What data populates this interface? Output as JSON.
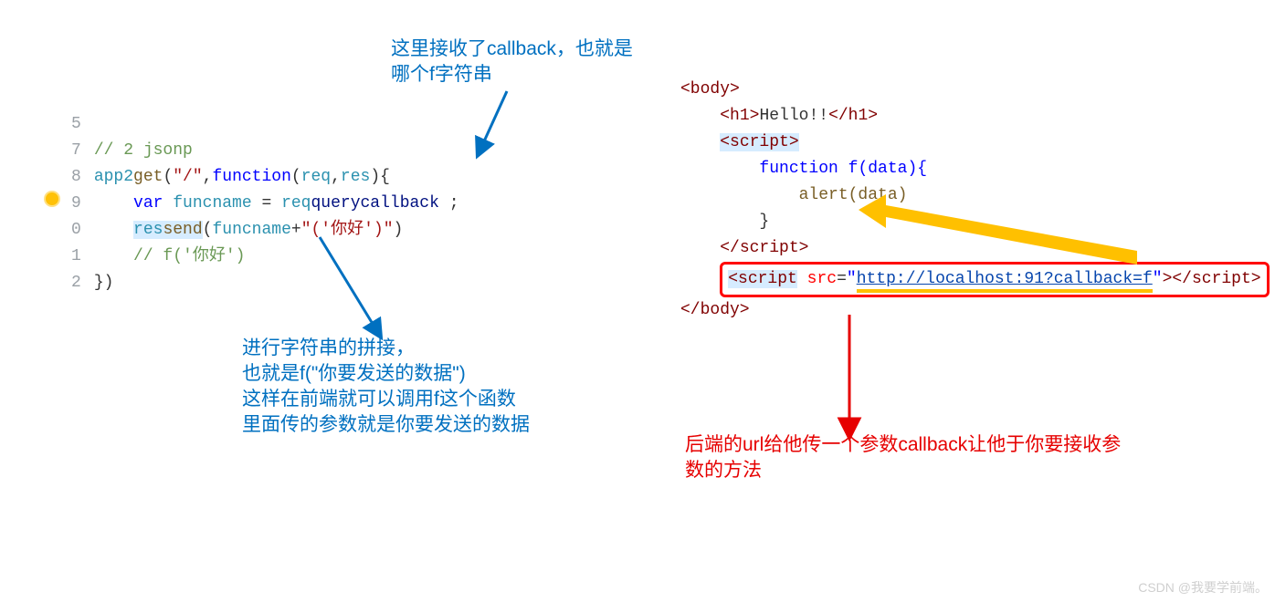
{
  "annotations": {
    "top": {
      "line1": "这里接收了callback，也就是",
      "line2": "哪个f字符串"
    },
    "left_bottom": {
      "line1": "进行字符串的拼接，",
      "line2": "也就是f(\"你要发送的数据\")",
      "line3": "这样在前端就可以调用f这个函数",
      "line4": "里面传的参数就是你要发送的数据"
    },
    "right_bottom": {
      "line1": "后端的url给他传一个参数callback让他于你要接收参",
      "line2": "数的方法"
    }
  },
  "left_code": {
    "gutter": [
      "5",
      "7",
      "8",
      "9",
      "0",
      "1",
      "2"
    ],
    "lines": {
      "l1": "",
      "l2_comment": "// 2 jsonp",
      "l3": {
        "a": "app2",
        ".": ".",
        "b": "get",
        "(": "(",
        "s": "\"/\"",
        ",": ",",
        "fn": "function",
        "(2": "(",
        "r": "req",
        ",2": ",",
        "rs": "res",
        "){": "){"
      },
      "l4": {
        "kw": "var",
        "sp": " ",
        "v": "funcname",
        " = ": " = ",
        "r": "req",
        ".": ".",
        "q": "query",
        ".2": ".",
        "cb": "callback",
        " ;": " ;"
      },
      "l5": {
        "r": "res",
        ".": ".",
        "s": "send",
        "(": "(",
        "v": "funcname",
        "+": "+",
        "str": "\"('你好')\"",
        "cl": ")"
      },
      "l6_comment": "// f('你好')",
      "l7": "})"
    }
  },
  "right_code": {
    "body_open": "<body>",
    "h1": {
      "open": "<h1>",
      "text": "Hello!!",
      "close": "</h1>"
    },
    "script_open": "<script>",
    "fn_line1": "function f(data){",
    "fn_line2": "alert(data)",
    "fn_line3": "}",
    "script_close": "</script>",
    "scr2": {
      "open": "<script",
      "sp": " ",
      "attr": "src",
      "eq": "=",
      "q": "\"",
      "url": "http://localhost:91?callback=f",
      "q2": "\"",
      "gt": ">",
      "close": "</script>"
    },
    "body_close": "</body>"
  },
  "watermark": "CSDN @我要学前端。"
}
